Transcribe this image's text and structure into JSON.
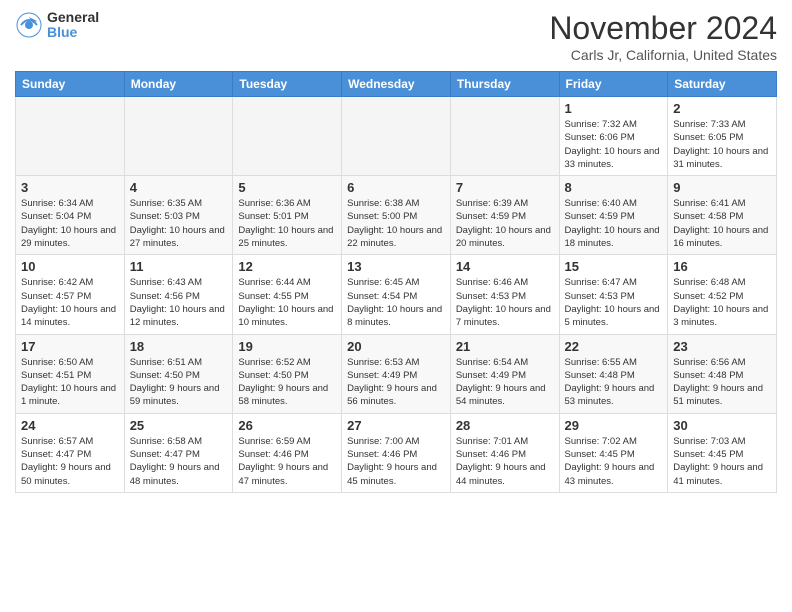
{
  "header": {
    "logo_general": "General",
    "logo_blue": "Blue",
    "month": "November 2024",
    "location": "Carls Jr, California, United States"
  },
  "days_of_week": [
    "Sunday",
    "Monday",
    "Tuesday",
    "Wednesday",
    "Thursday",
    "Friday",
    "Saturday"
  ],
  "weeks": [
    [
      {
        "day": "",
        "detail": ""
      },
      {
        "day": "",
        "detail": ""
      },
      {
        "day": "",
        "detail": ""
      },
      {
        "day": "",
        "detail": ""
      },
      {
        "day": "",
        "detail": ""
      },
      {
        "day": "1",
        "detail": "Sunrise: 7:32 AM\nSunset: 6:06 PM\nDaylight: 10 hours and 33 minutes."
      },
      {
        "day": "2",
        "detail": "Sunrise: 7:33 AM\nSunset: 6:05 PM\nDaylight: 10 hours and 31 minutes."
      }
    ],
    [
      {
        "day": "3",
        "detail": "Sunrise: 6:34 AM\nSunset: 5:04 PM\nDaylight: 10 hours and 29 minutes."
      },
      {
        "day": "4",
        "detail": "Sunrise: 6:35 AM\nSunset: 5:03 PM\nDaylight: 10 hours and 27 minutes."
      },
      {
        "day": "5",
        "detail": "Sunrise: 6:36 AM\nSunset: 5:01 PM\nDaylight: 10 hours and 25 minutes."
      },
      {
        "day": "6",
        "detail": "Sunrise: 6:38 AM\nSunset: 5:00 PM\nDaylight: 10 hours and 22 minutes."
      },
      {
        "day": "7",
        "detail": "Sunrise: 6:39 AM\nSunset: 4:59 PM\nDaylight: 10 hours and 20 minutes."
      },
      {
        "day": "8",
        "detail": "Sunrise: 6:40 AM\nSunset: 4:59 PM\nDaylight: 10 hours and 18 minutes."
      },
      {
        "day": "9",
        "detail": "Sunrise: 6:41 AM\nSunset: 4:58 PM\nDaylight: 10 hours and 16 minutes."
      }
    ],
    [
      {
        "day": "10",
        "detail": "Sunrise: 6:42 AM\nSunset: 4:57 PM\nDaylight: 10 hours and 14 minutes."
      },
      {
        "day": "11",
        "detail": "Sunrise: 6:43 AM\nSunset: 4:56 PM\nDaylight: 10 hours and 12 minutes."
      },
      {
        "day": "12",
        "detail": "Sunrise: 6:44 AM\nSunset: 4:55 PM\nDaylight: 10 hours and 10 minutes."
      },
      {
        "day": "13",
        "detail": "Sunrise: 6:45 AM\nSunset: 4:54 PM\nDaylight: 10 hours and 8 minutes."
      },
      {
        "day": "14",
        "detail": "Sunrise: 6:46 AM\nSunset: 4:53 PM\nDaylight: 10 hours and 7 minutes."
      },
      {
        "day": "15",
        "detail": "Sunrise: 6:47 AM\nSunset: 4:53 PM\nDaylight: 10 hours and 5 minutes."
      },
      {
        "day": "16",
        "detail": "Sunrise: 6:48 AM\nSunset: 4:52 PM\nDaylight: 10 hours and 3 minutes."
      }
    ],
    [
      {
        "day": "17",
        "detail": "Sunrise: 6:50 AM\nSunset: 4:51 PM\nDaylight: 10 hours and 1 minute."
      },
      {
        "day": "18",
        "detail": "Sunrise: 6:51 AM\nSunset: 4:50 PM\nDaylight: 9 hours and 59 minutes."
      },
      {
        "day": "19",
        "detail": "Sunrise: 6:52 AM\nSunset: 4:50 PM\nDaylight: 9 hours and 58 minutes."
      },
      {
        "day": "20",
        "detail": "Sunrise: 6:53 AM\nSunset: 4:49 PM\nDaylight: 9 hours and 56 minutes."
      },
      {
        "day": "21",
        "detail": "Sunrise: 6:54 AM\nSunset: 4:49 PM\nDaylight: 9 hours and 54 minutes."
      },
      {
        "day": "22",
        "detail": "Sunrise: 6:55 AM\nSunset: 4:48 PM\nDaylight: 9 hours and 53 minutes."
      },
      {
        "day": "23",
        "detail": "Sunrise: 6:56 AM\nSunset: 4:48 PM\nDaylight: 9 hours and 51 minutes."
      }
    ],
    [
      {
        "day": "24",
        "detail": "Sunrise: 6:57 AM\nSunset: 4:47 PM\nDaylight: 9 hours and 50 minutes."
      },
      {
        "day": "25",
        "detail": "Sunrise: 6:58 AM\nSunset: 4:47 PM\nDaylight: 9 hours and 48 minutes."
      },
      {
        "day": "26",
        "detail": "Sunrise: 6:59 AM\nSunset: 4:46 PM\nDaylight: 9 hours and 47 minutes."
      },
      {
        "day": "27",
        "detail": "Sunrise: 7:00 AM\nSunset: 4:46 PM\nDaylight: 9 hours and 45 minutes."
      },
      {
        "day": "28",
        "detail": "Sunrise: 7:01 AM\nSunset: 4:46 PM\nDaylight: 9 hours and 44 minutes."
      },
      {
        "day": "29",
        "detail": "Sunrise: 7:02 AM\nSunset: 4:45 PM\nDaylight: 9 hours and 43 minutes."
      },
      {
        "day": "30",
        "detail": "Sunrise: 7:03 AM\nSunset: 4:45 PM\nDaylight: 9 hours and 41 minutes."
      }
    ]
  ]
}
